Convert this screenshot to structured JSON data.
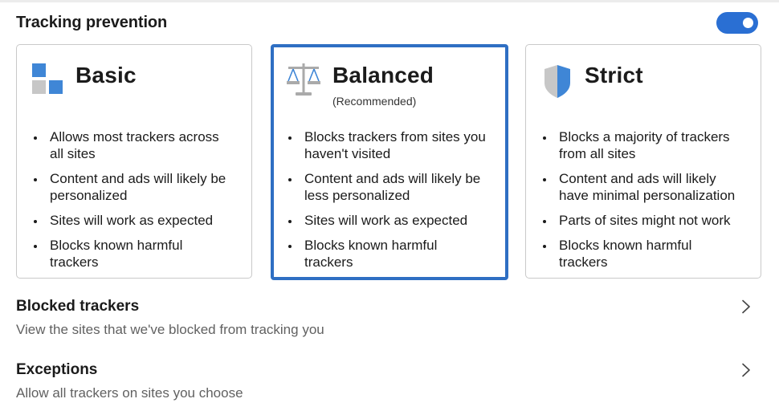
{
  "header": {
    "title": "Tracking prevention",
    "toggle_on": true
  },
  "cards": [
    {
      "id": "basic",
      "title": "Basic",
      "subtitle": "",
      "selected": false,
      "icon": "basic-squares-icon",
      "bullets": [
        "Allows most trackers across all sites",
        "Content and ads will likely be personalized",
        "Sites will work as expected",
        "Blocks known harmful trackers"
      ]
    },
    {
      "id": "balanced",
      "title": "Balanced",
      "subtitle": "(Recommended)",
      "selected": true,
      "icon": "scales-icon",
      "bullets": [
        "Blocks trackers from sites you haven't visited",
        "Content and ads will likely be less personalized",
        "Sites will work as expected",
        "Blocks known harmful trackers"
      ]
    },
    {
      "id": "strict",
      "title": "Strict",
      "subtitle": "",
      "selected": false,
      "icon": "shield-icon",
      "bullets": [
        "Blocks a majority of trackers from all sites",
        "Content and ads will likely have minimal personalization",
        "Parts of sites might not work",
        "Blocks known harmful trackers"
      ]
    }
  ],
  "blocked_trackers": {
    "title": "Blocked trackers",
    "description": "View the sites that we've blocked from tracking you"
  },
  "exceptions": {
    "title": "Exceptions",
    "description": "Allow all trackers on sites you choose"
  },
  "colors": {
    "accent": "#2a6fd3",
    "selected_border": "#2f6fc3",
    "icon_blue": "#3f86d6",
    "icon_gray": "#c7c7c7"
  }
}
